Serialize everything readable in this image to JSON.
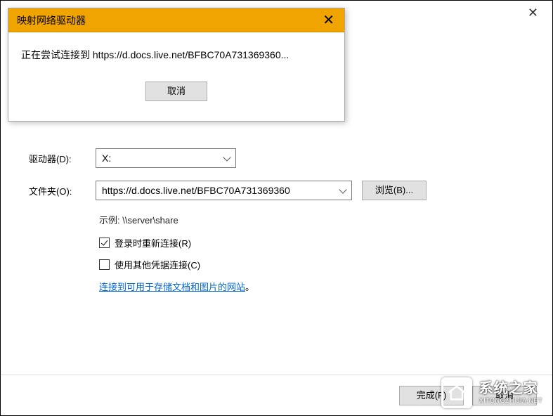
{
  "window": {
    "close_icon_title": "Close"
  },
  "popup": {
    "title": "映射网络驱动器",
    "message": "正在尝试连接到 https://d.docs.live.net/BFBC70A731369360...",
    "cancel_label": "取消"
  },
  "form": {
    "drive_label": "驱动器(D):",
    "drive_value": "X:",
    "folder_label": "文件夹(O):",
    "folder_value": "https://d.docs.live.net/BFBC70A731369360",
    "browse_label": "浏览(B)...",
    "example_text": "示例: \\\\server\\share",
    "reconnect_label": "登录时重新连接(R)",
    "reconnect_checked": true,
    "othercred_label": "使用其他凭据连接(C)",
    "othercred_checked": false,
    "link_text": "连接到可用于存储文档和图片的网站",
    "link_period": "。"
  },
  "footer": {
    "finish_label": "完成(F)",
    "cancel_label": "取消"
  },
  "watermark": {
    "cn": "系统之家",
    "en": "XITONGZHIJIA.NET"
  }
}
